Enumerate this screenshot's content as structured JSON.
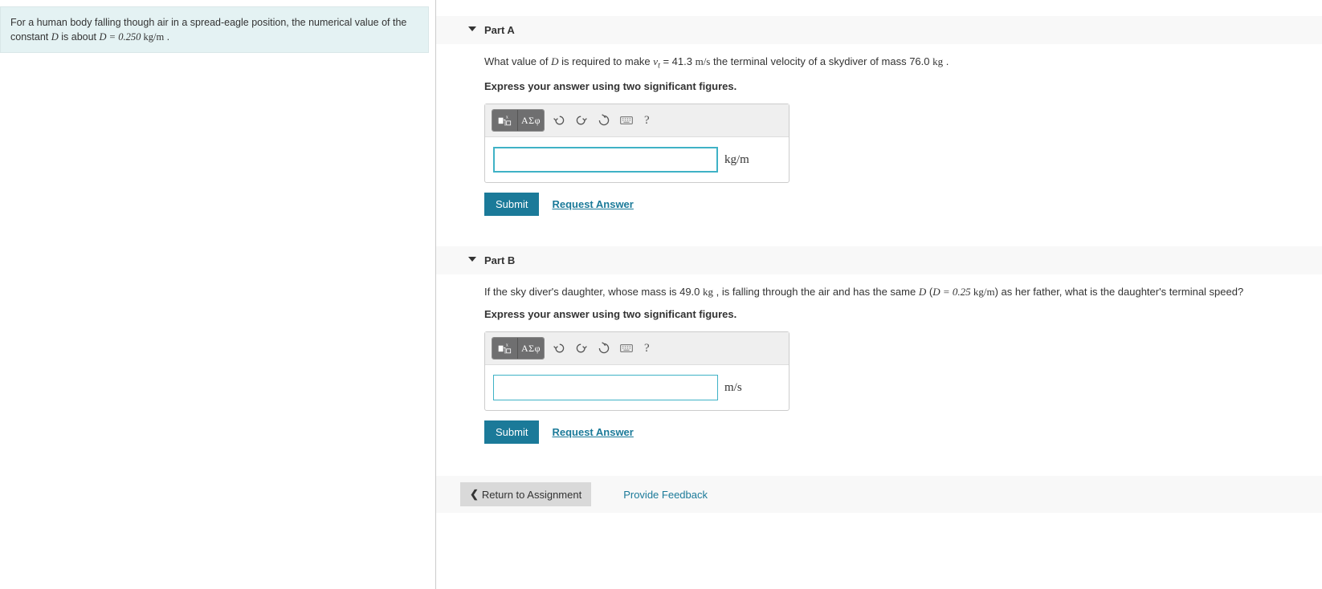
{
  "info": {
    "text_before": "For a human body falling though air in a spread-eagle position, the numerical value of the constant ",
    "var": "D",
    "text_mid": " is about ",
    "eq": "D = 0.250 ",
    "units": "kg/m",
    "text_after": " ."
  },
  "partA": {
    "title": "Part A",
    "prompt": {
      "p1": "What value of ",
      "var1": "D",
      "p2": " is required to make ",
      "vvar": "v",
      "vsub": "t",
      "p3": " = 41.3 ",
      "u1": "m/s",
      "p4": " the terminal velocity of a skydiver of mass 76.0 ",
      "u2": "kg",
      "p5": " ."
    },
    "instruct": "Express your answer using two significant figures.",
    "unit": "kg/m",
    "submit": "Submit",
    "request": "Request Answer",
    "greek": "ΑΣφ"
  },
  "partB": {
    "title": "Part B",
    "prompt": {
      "p1": "If the sky diver's daughter, whose mass is 49.0 ",
      "u1": "kg",
      "p2": " , is falling through the air and has the same ",
      "var1": "D",
      "p3": " (",
      "eq": "D = 0.25 ",
      "u2": "kg/m",
      "p4": ") as her father, what is the daughter's terminal speed?"
    },
    "instruct": "Express your answer using two significant figures.",
    "unit": "m/s",
    "submit": "Submit",
    "request": "Request Answer",
    "greek": "ΑΣφ"
  },
  "footer": {
    "return": "Return to Assignment",
    "feedback": "Provide Feedback"
  },
  "help": "?"
}
